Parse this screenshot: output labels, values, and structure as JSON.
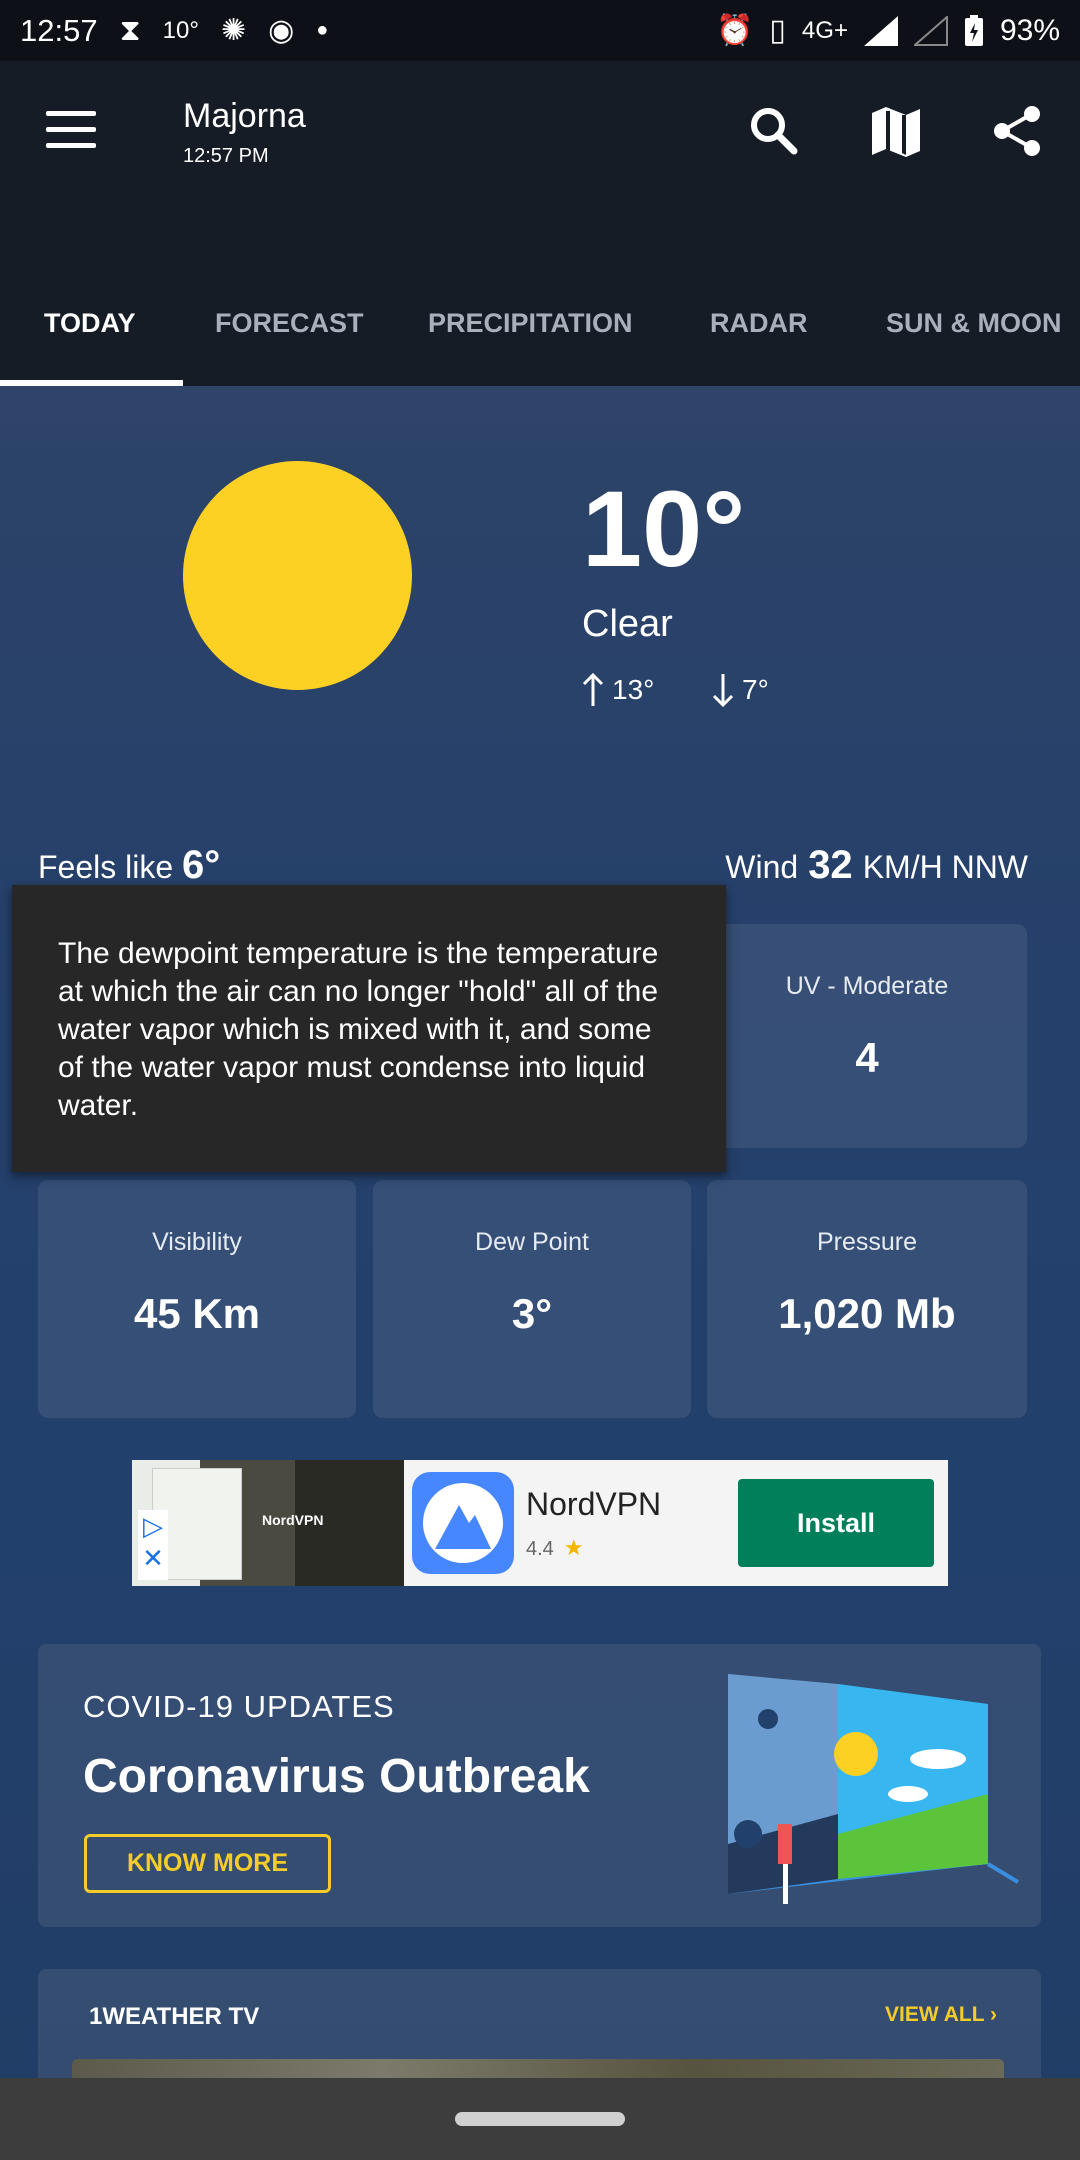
{
  "status_bar": {
    "time": "12:57",
    "temp": "10°",
    "network": "4G+",
    "battery": "93%"
  },
  "app_bar": {
    "location": "Majorna",
    "time": "12:57 PM",
    "icons": [
      "menu-icon",
      "search-icon",
      "map-icon",
      "share-icon"
    ]
  },
  "tabs": [
    {
      "label": "TODAY",
      "active": true
    },
    {
      "label": "FORECAST"
    },
    {
      "label": "PRECIPITATION"
    },
    {
      "label": "RADAR"
    },
    {
      "label": "SUN & MOON"
    }
  ],
  "current": {
    "temperature": "10°",
    "condition": "Clear",
    "high": "13°",
    "low": "7°",
    "feels_like_label": "Feels like",
    "feels_like_value": "6°",
    "wind_label": "Wind",
    "wind_value": "32",
    "wind_unit": "KM/H NNW",
    "sun_color": "#fdd124"
  },
  "cards": {
    "uv": {
      "label": "UV - Moderate",
      "value": "4"
    },
    "visibility": {
      "label": "Visibility",
      "value": "45 Km"
    },
    "dew_point": {
      "label": "Dew Point",
      "value": "3°"
    },
    "pressure": {
      "label": "Pressure",
      "value": "1,020 Mb"
    }
  },
  "tooltip": {
    "text": "The dewpoint temperature is the temperature at which the air can no longer \"hold\" all of the water vapor which is mixed with it, and some of the water vapor must condense into liquid water."
  },
  "ad": {
    "brand_overlay": "NordVPN",
    "name": "NordVPN",
    "rating": "4.4",
    "install_label": "Install",
    "install_color": "#017f5a"
  },
  "covid": {
    "kicker": "COVID-19 UPDATES",
    "title": "Coronavirus Outbreak",
    "button": "KNOW MORE",
    "accent": "#f5cc29"
  },
  "tv": {
    "title": "1WEATHER TV",
    "view_all": "VIEW ALL"
  }
}
